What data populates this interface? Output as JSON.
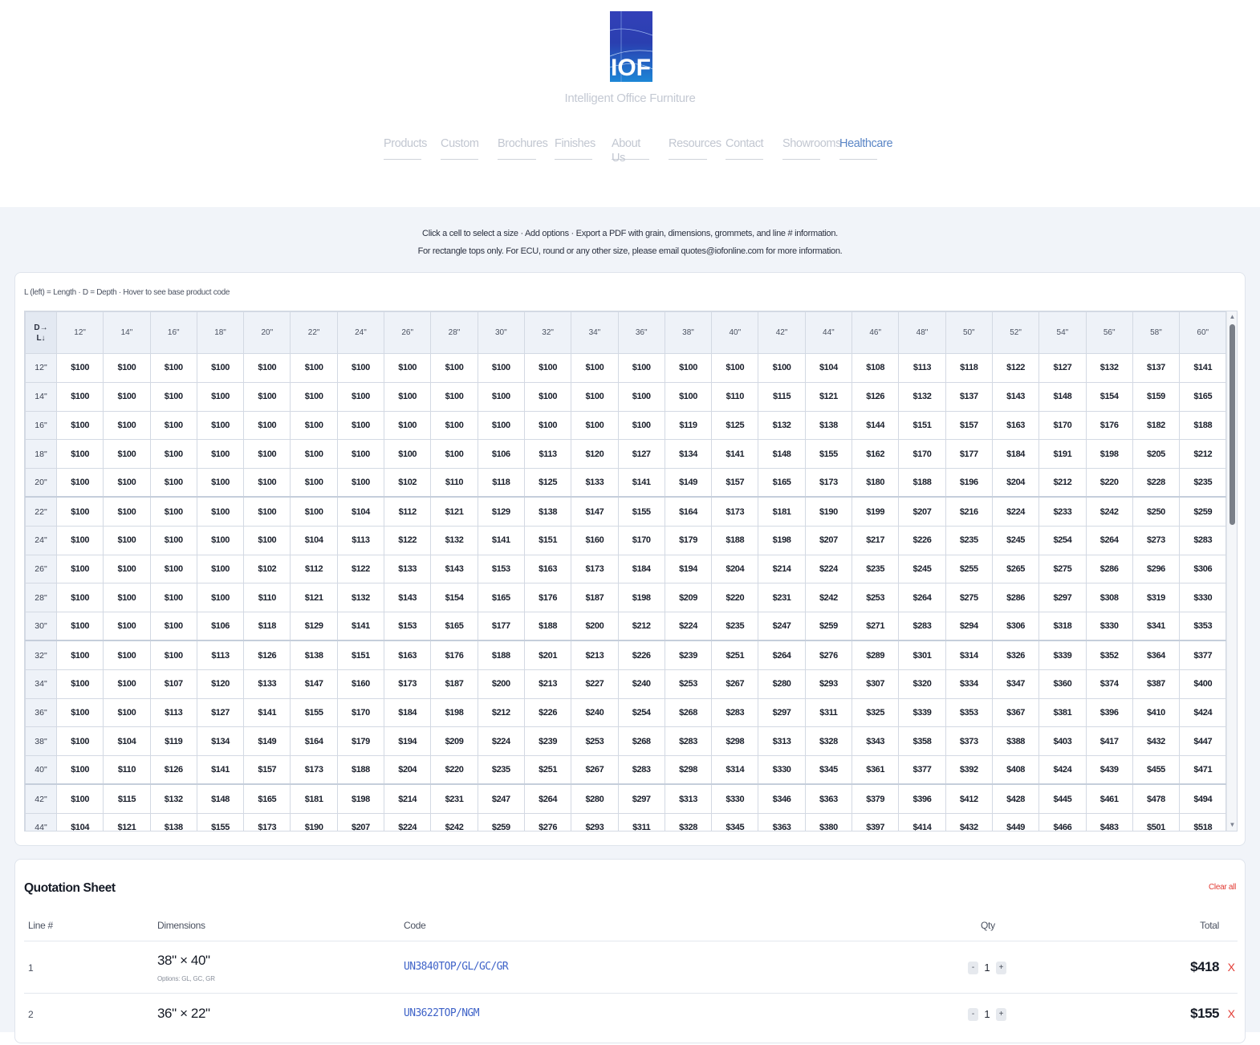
{
  "brand": {
    "logo_text": "IOF",
    "tagline": "Intelligent Office Furniture"
  },
  "nav": [
    {
      "label": "Products",
      "active": false
    },
    {
      "label": "Custom",
      "active": false
    },
    {
      "label": "Brochures",
      "active": false
    },
    {
      "label": "Finishes",
      "active": false
    },
    {
      "label": "About Us",
      "active": false
    },
    {
      "label": "Resources",
      "active": false
    },
    {
      "label": "Contact",
      "active": false
    },
    {
      "label": "Showrooms",
      "active": false
    },
    {
      "label": "Healthcare",
      "active": true
    }
  ],
  "intro": {
    "line1": "Click a cell to select a size · Add options · Export a PDF with grain, dimensions, grommets, and line # information.",
    "line2": "For rectangle tops only. For ECU, round or any other size, please email quotes@iofonline.com for more information."
  },
  "grid": {
    "hint": "L (left) = Length · D = Depth · Hover to see base product code",
    "corner_top": "D→",
    "corner_bottom": "L↓",
    "columns": [
      "12\"",
      "14\"",
      "16\"",
      "18\"",
      "20\"",
      "22\"",
      "24\"",
      "26\"",
      "28\"",
      "30\"",
      "32\"",
      "34\"",
      "36\"",
      "38\"",
      "40\"",
      "42\"",
      "44\"",
      "46\"",
      "48\"",
      "50\"",
      "52\"",
      "54\"",
      "56\"",
      "58\"",
      "60\""
    ],
    "rows": [
      {
        "label": "12\"",
        "prices": [
          "$100",
          "$100",
          "$100",
          "$100",
          "$100",
          "$100",
          "$100",
          "$100",
          "$100",
          "$100",
          "$100",
          "$100",
          "$100",
          "$100",
          "$100",
          "$100",
          "$104",
          "$108",
          "$113",
          "$118",
          "$122",
          "$127",
          "$132",
          "$137",
          "$141"
        ]
      },
      {
        "label": "14\"",
        "prices": [
          "$100",
          "$100",
          "$100",
          "$100",
          "$100",
          "$100",
          "$100",
          "$100",
          "$100",
          "$100",
          "$100",
          "$100",
          "$100",
          "$100",
          "$110",
          "$115",
          "$121",
          "$126",
          "$132",
          "$137",
          "$143",
          "$148",
          "$154",
          "$159",
          "$165"
        ]
      },
      {
        "label": "16\"",
        "prices": [
          "$100",
          "$100",
          "$100",
          "$100",
          "$100",
          "$100",
          "$100",
          "$100",
          "$100",
          "$100",
          "$100",
          "$100",
          "$100",
          "$119",
          "$125",
          "$132",
          "$138",
          "$144",
          "$151",
          "$157",
          "$163",
          "$170",
          "$176",
          "$182",
          "$188"
        ]
      },
      {
        "label": "18\"",
        "prices": [
          "$100",
          "$100",
          "$100",
          "$100",
          "$100",
          "$100",
          "$100",
          "$100",
          "$100",
          "$106",
          "$113",
          "$120",
          "$127",
          "$134",
          "$141",
          "$148",
          "$155",
          "$162",
          "$170",
          "$177",
          "$184",
          "$191",
          "$198",
          "$205",
          "$212"
        ]
      },
      {
        "label": "20\"",
        "prices": [
          "$100",
          "$100",
          "$100",
          "$100",
          "$100",
          "$100",
          "$100",
          "$102",
          "$110",
          "$118",
          "$125",
          "$133",
          "$141",
          "$149",
          "$157",
          "$165",
          "$173",
          "$180",
          "$188",
          "$196",
          "$204",
          "$212",
          "$220",
          "$228",
          "$235"
        ]
      },
      {
        "label": "22\"",
        "prices": [
          "$100",
          "$100",
          "$100",
          "$100",
          "$100",
          "$100",
          "$104",
          "$112",
          "$121",
          "$129",
          "$138",
          "$147",
          "$155",
          "$164",
          "$173",
          "$181",
          "$190",
          "$199",
          "$207",
          "$216",
          "$224",
          "$233",
          "$242",
          "$250",
          "$259"
        ]
      },
      {
        "label": "24\"",
        "prices": [
          "$100",
          "$100",
          "$100",
          "$100",
          "$100",
          "$104",
          "$113",
          "$122",
          "$132",
          "$141",
          "$151",
          "$160",
          "$170",
          "$179",
          "$188",
          "$198",
          "$207",
          "$217",
          "$226",
          "$235",
          "$245",
          "$254",
          "$264",
          "$273",
          "$283"
        ]
      },
      {
        "label": "26\"",
        "prices": [
          "$100",
          "$100",
          "$100",
          "$100",
          "$102",
          "$112",
          "$122",
          "$133",
          "$143",
          "$153",
          "$163",
          "$173",
          "$184",
          "$194",
          "$204",
          "$214",
          "$224",
          "$235",
          "$245",
          "$255",
          "$265",
          "$275",
          "$286",
          "$296",
          "$306"
        ]
      },
      {
        "label": "28\"",
        "prices": [
          "$100",
          "$100",
          "$100",
          "$100",
          "$110",
          "$121",
          "$132",
          "$143",
          "$154",
          "$165",
          "$176",
          "$187",
          "$198",
          "$209",
          "$220",
          "$231",
          "$242",
          "$253",
          "$264",
          "$275",
          "$286",
          "$297",
          "$308",
          "$319",
          "$330"
        ]
      },
      {
        "label": "30\"",
        "prices": [
          "$100",
          "$100",
          "$100",
          "$106",
          "$118",
          "$129",
          "$141",
          "$153",
          "$165",
          "$177",
          "$188",
          "$200",
          "$212",
          "$224",
          "$235",
          "$247",
          "$259",
          "$271",
          "$283",
          "$294",
          "$306",
          "$318",
          "$330",
          "$341",
          "$353"
        ]
      },
      {
        "label": "32\"",
        "prices": [
          "$100",
          "$100",
          "$100",
          "$113",
          "$126",
          "$138",
          "$151",
          "$163",
          "$176",
          "$188",
          "$201",
          "$213",
          "$226",
          "$239",
          "$251",
          "$264",
          "$276",
          "$289",
          "$301",
          "$314",
          "$326",
          "$339",
          "$352",
          "$364",
          "$377"
        ]
      },
      {
        "label": "34\"",
        "prices": [
          "$100",
          "$100",
          "$107",
          "$120",
          "$133",
          "$147",
          "$160",
          "$173",
          "$187",
          "$200",
          "$213",
          "$227",
          "$240",
          "$253",
          "$267",
          "$280",
          "$293",
          "$307",
          "$320",
          "$334",
          "$347",
          "$360",
          "$374",
          "$387",
          "$400"
        ]
      },
      {
        "label": "36\"",
        "prices": [
          "$100",
          "$100",
          "$113",
          "$127",
          "$141",
          "$155",
          "$170",
          "$184",
          "$198",
          "$212",
          "$226",
          "$240",
          "$254",
          "$268",
          "$283",
          "$297",
          "$311",
          "$325",
          "$339",
          "$353",
          "$367",
          "$381",
          "$396",
          "$410",
          "$424"
        ]
      },
      {
        "label": "38\"",
        "prices": [
          "$100",
          "$104",
          "$119",
          "$134",
          "$149",
          "$164",
          "$179",
          "$194",
          "$209",
          "$224",
          "$239",
          "$253",
          "$268",
          "$283",
          "$298",
          "$313",
          "$328",
          "$343",
          "$358",
          "$373",
          "$388",
          "$403",
          "$417",
          "$432",
          "$447"
        ]
      },
      {
        "label": "40\"",
        "prices": [
          "$100",
          "$110",
          "$126",
          "$141",
          "$157",
          "$173",
          "$188",
          "$204",
          "$220",
          "$235",
          "$251",
          "$267",
          "$283",
          "$298",
          "$314",
          "$330",
          "$345",
          "$361",
          "$377",
          "$392",
          "$408",
          "$424",
          "$439",
          "$455",
          "$471"
        ]
      },
      {
        "label": "42\"",
        "prices": [
          "$100",
          "$115",
          "$132",
          "$148",
          "$165",
          "$181",
          "$198",
          "$214",
          "$231",
          "$247",
          "$264",
          "$280",
          "$297",
          "$313",
          "$330",
          "$346",
          "$363",
          "$379",
          "$396",
          "$412",
          "$428",
          "$445",
          "$461",
          "$478",
          "$494"
        ]
      },
      {
        "label": "44\"",
        "prices": [
          "$104",
          "$121",
          "$138",
          "$155",
          "$173",
          "$190",
          "$207",
          "$224",
          "$242",
          "$259",
          "$276",
          "$293",
          "$311",
          "$328",
          "$345",
          "$363",
          "$380",
          "$397",
          "$414",
          "$432",
          "$449",
          "$466",
          "$483",
          "$501",
          "$518"
        ]
      }
    ]
  },
  "quote": {
    "title": "Quotation Sheet",
    "clear_label": "Clear all",
    "headers": {
      "line": "Line #",
      "dimensions": "Dimensions",
      "code": "Code",
      "qty": "Qty",
      "total": "Total"
    },
    "rows": [
      {
        "line": "1",
        "dimensions": "38\" × 40\"",
        "options": "Options: GL, GC, GR",
        "code": "UN3840TOP/GL/GC/GR",
        "qty": "1",
        "total": "$418",
        "remove": "X"
      },
      {
        "line": "2",
        "dimensions": "36\" × 22\"",
        "options": "",
        "code": "UN3622TOP/NGM",
        "qty": "1",
        "total": "$155",
        "remove": "X"
      }
    ],
    "qty_minus": "-",
    "qty_plus": "+"
  },
  "colors": {
    "accent": "#3f63c8",
    "active_nav": "#5b86c6",
    "danger": "#e23a33",
    "logo_top": "#3340b8",
    "logo_bottom": "#1d86d6"
  },
  "icons": [
    "up-arrow-icon",
    "down-arrow-icon",
    "remove-x-icon"
  ]
}
